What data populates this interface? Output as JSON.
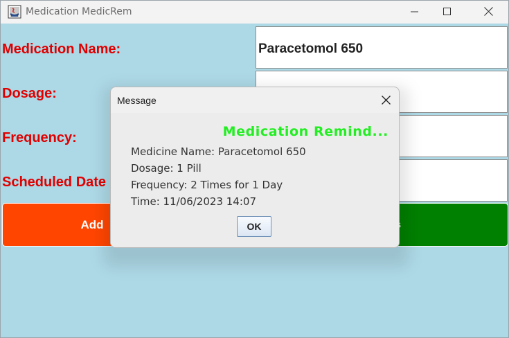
{
  "window": {
    "title": "Medication MedicRem",
    "icon": "java-app-icon"
  },
  "form": {
    "name_label": "Medication Name:",
    "name_value": "Paracetomol 650",
    "dosage_label": "Dosage:",
    "frequency_label": "Frequency:",
    "scheduled_label": "Scheduled Date a"
  },
  "buttons": {
    "add_label": "Add",
    "view_label": "nders",
    "add_color": "#ff4500",
    "view_color": "#008000"
  },
  "dialog": {
    "title": "Message",
    "heading": "Medication Remind...",
    "heading_color": "#22ee22",
    "lines": [
      "Medicine Name: Paracetomol 650",
      "Dosage: 1 Pill",
      "Frequency: 2 Times for 1 Day",
      "Time: 11/06/2023 14:07"
    ],
    "ok_label": "OK"
  },
  "colors": {
    "background": "#add8e6",
    "label": "#e00000"
  }
}
